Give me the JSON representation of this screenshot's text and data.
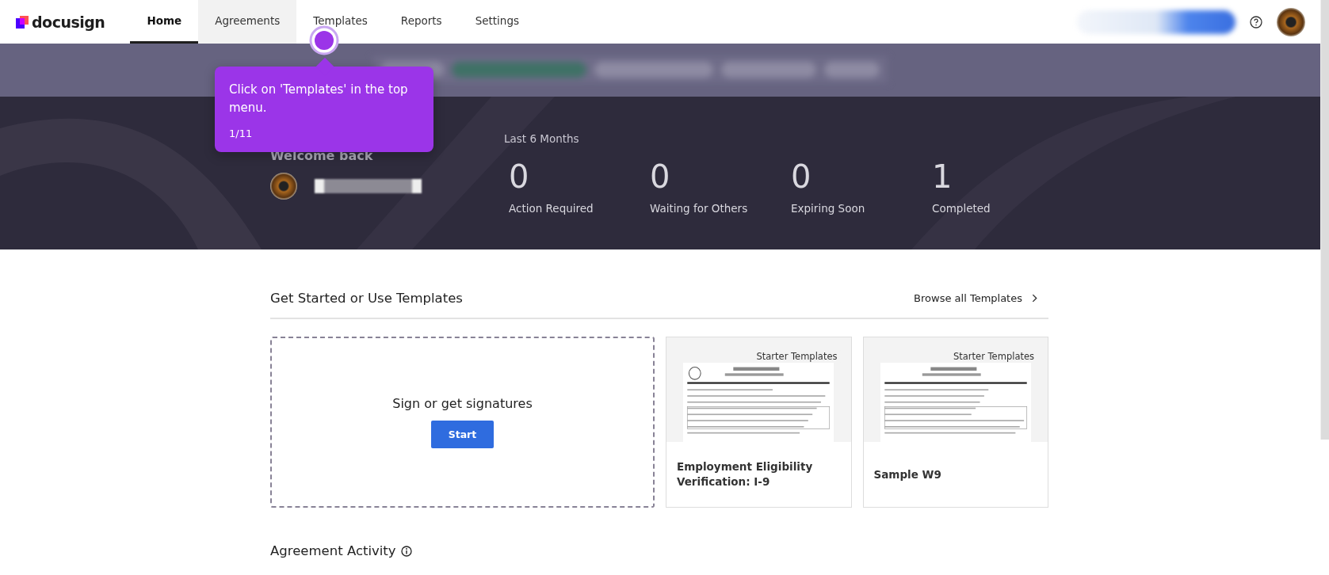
{
  "nav": {
    "logo": "docusign",
    "tabs": [
      {
        "label": "Home",
        "selected": true,
        "hover": false
      },
      {
        "label": "Agreements",
        "selected": false,
        "hover": true
      },
      {
        "label": "Templates",
        "selected": false,
        "hover": false
      },
      {
        "label": "Reports",
        "selected": false,
        "hover": false
      },
      {
        "label": "Settings",
        "selected": false,
        "hover": false
      }
    ]
  },
  "tooltip": {
    "text": "Click on 'Templates' in the top menu.",
    "step": "1/11"
  },
  "hero": {
    "welcome": "Welcome back",
    "period": "Last 6 Months",
    "stats": [
      {
        "value": "0",
        "label": "Action Required"
      },
      {
        "value": "0",
        "label": "Waiting for Others"
      },
      {
        "value": "0",
        "label": "Expiring Soon"
      },
      {
        "value": "1",
        "label": "Completed"
      }
    ]
  },
  "templates": {
    "title": "Get Started or Use Templates",
    "browse": "Browse all Templates",
    "start_card": {
      "text": "Sign or get signatures",
      "button": "Start"
    },
    "cards": [
      {
        "badge": "Starter Templates",
        "name": "Employment Eligibility Verification: I-9"
      },
      {
        "badge": "Starter Templates",
        "name": "Sample W9"
      }
    ]
  },
  "activity": {
    "title": "Agreement Activity"
  }
}
